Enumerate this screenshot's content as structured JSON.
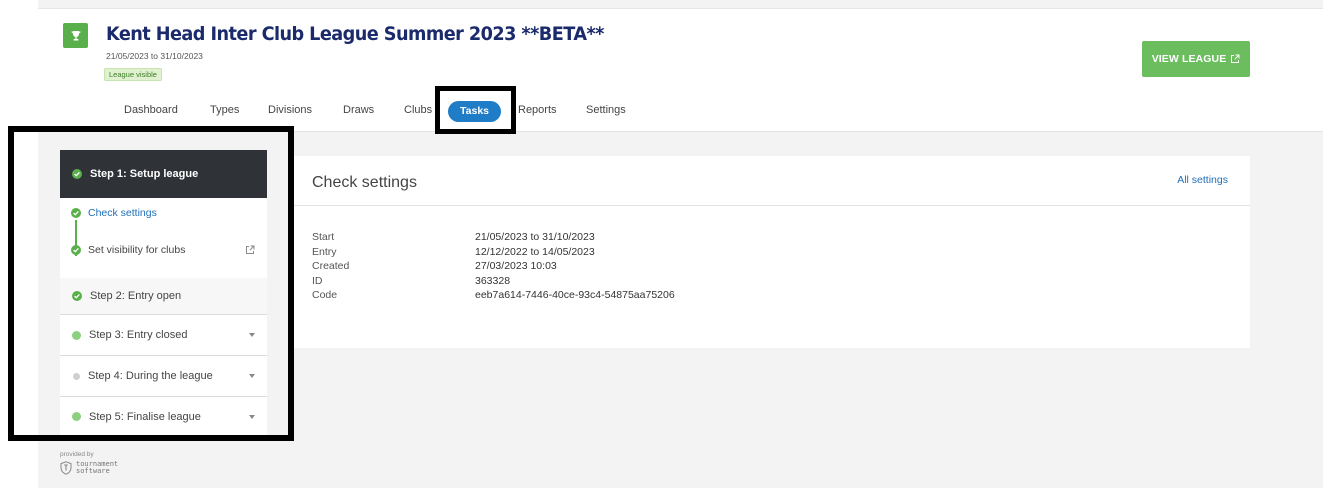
{
  "league": {
    "title": "Kent Head Inter Club League Summer 2023 **BETA**",
    "dates": "21/05/2023 to 31/10/2023",
    "visibility_badge": "League visible",
    "view_button": "VIEW LEAGUE"
  },
  "nav": {
    "items": [
      {
        "label": "Dashboard"
      },
      {
        "label": "Types"
      },
      {
        "label": "Divisions"
      },
      {
        "label": "Draws"
      },
      {
        "label": "Clubs"
      },
      {
        "label": "Tasks",
        "active": true
      },
      {
        "label": "Reports"
      },
      {
        "label": "Settings"
      }
    ]
  },
  "steps": {
    "step1": {
      "label": "Step 1: Setup league",
      "status": "done"
    },
    "substeps": [
      {
        "label": "Check settings",
        "status": "done"
      },
      {
        "label": "Set visibility for clubs",
        "status": "done"
      }
    ],
    "step2": {
      "label": "Step 2: Entry open",
      "status": "done"
    },
    "step3": {
      "label": "Step 3: Entry closed",
      "status": "pending"
    },
    "step4": {
      "label": "Step 4: During the league",
      "status": "inactive"
    },
    "step5": {
      "label": "Step 5: Finalise league",
      "status": "pending"
    }
  },
  "panel": {
    "title": "Check settings",
    "all_settings": "All settings",
    "rows": [
      {
        "key": "Start",
        "value": "21/05/2023 to 31/10/2023"
      },
      {
        "key": "Entry",
        "value": "12/12/2022 to 14/05/2023"
      },
      {
        "key": "Created",
        "value": "27/03/2023 10:03"
      },
      {
        "key": "ID",
        "value": "363328"
      },
      {
        "key": "Code",
        "value": "eeb7a614-7446-40ce-93c4-54875aa75206"
      }
    ]
  },
  "footer": {
    "provided_by": "provided by",
    "logo_line1": "tournament",
    "logo_line2": "software"
  },
  "colors": {
    "brand_green": "#59b04a",
    "button_green": "#6bbd5e",
    "active_tab_blue": "#1f7cc6",
    "title_navy": "#1a2a6b",
    "sidebar_dark": "#2f3338"
  }
}
